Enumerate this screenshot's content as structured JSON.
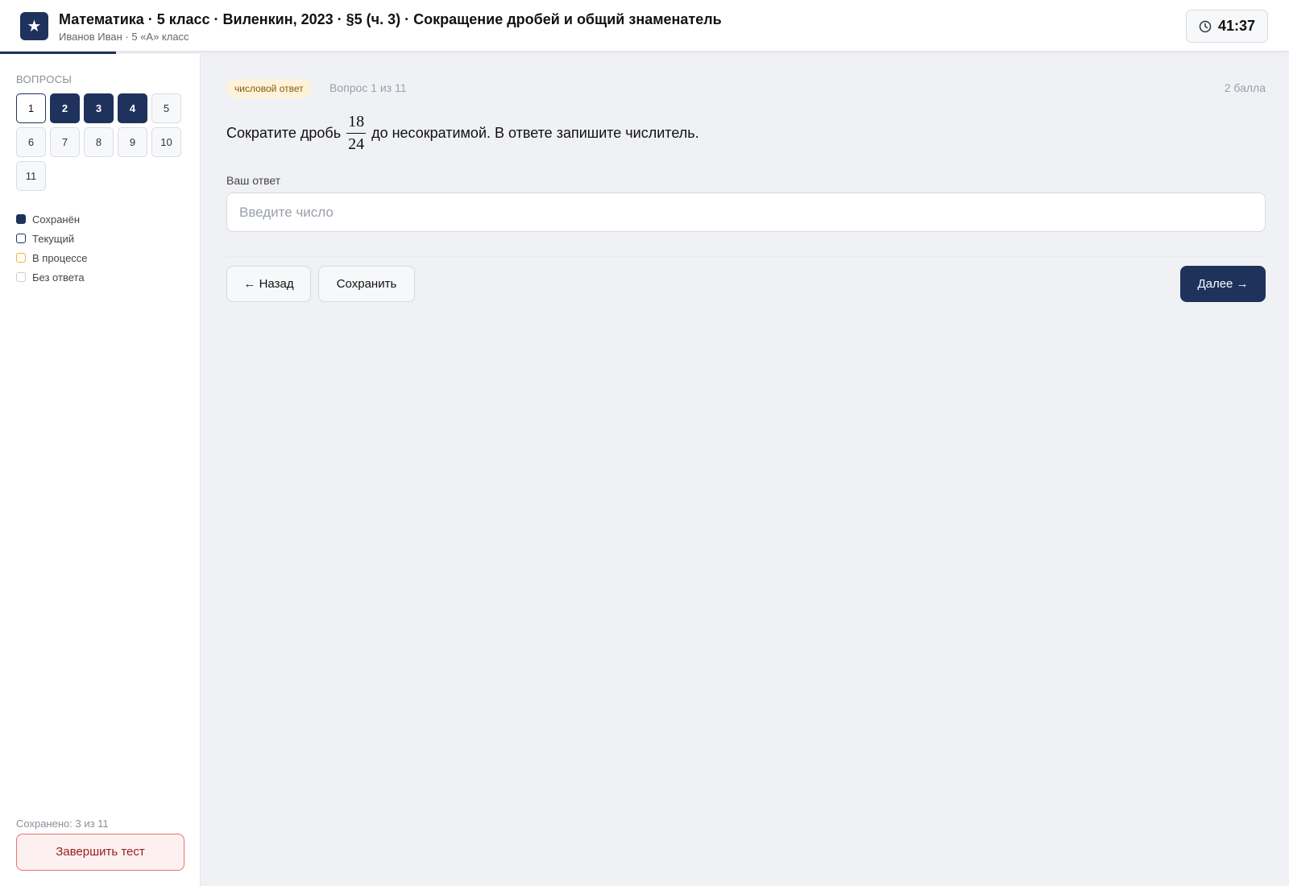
{
  "header": {
    "logo_glyph": "★",
    "title": "Математика · 5 класс · Виленкин, 2023 · §5 (ч. 3) · Сокращение дробей и общий знаменатель",
    "subtitle": "Иванов Иван · 5 «А» класс",
    "timer": "41:37"
  },
  "sidebar": {
    "heading": "ВОПРОСЫ",
    "questions": [
      {
        "label": "1",
        "state": "current"
      },
      {
        "label": "2",
        "state": "saved"
      },
      {
        "label": "3",
        "state": "saved"
      },
      {
        "label": "4",
        "state": "saved"
      },
      {
        "label": "5",
        "state": "none"
      },
      {
        "label": "6",
        "state": "none"
      },
      {
        "label": "7",
        "state": "none"
      },
      {
        "label": "8",
        "state": "none"
      },
      {
        "label": "9",
        "state": "none"
      },
      {
        "label": "10",
        "state": "none"
      },
      {
        "label": "11",
        "state": "none"
      }
    ],
    "legend": {
      "saved": "Сохранён",
      "current": "Текущий",
      "in_progress": "В процессе",
      "no_answer": "Без ответа"
    },
    "saved_count": "Сохранено: 3 из 11",
    "finish_label": "Завершить тест"
  },
  "main": {
    "badge": "числовой ответ",
    "question_number": "Вопрос 1 из 11",
    "points": "2 балла",
    "question_before": "Сократите дробь",
    "fraction_numerator": "18",
    "fraction_denominator": "24",
    "question_after": "до несократимой. В ответе запишите числитель.",
    "answer_label": "Ваш ответ",
    "answer_value": "",
    "answer_placeholder": "Введите число",
    "back_label": "← Назад",
    "save_label": "Сохранить",
    "next_label": "Далее →"
  },
  "colors": {
    "accent": "#1e325c",
    "badge_bg": "#fdf3dc",
    "in_progress": "#f0b429",
    "danger": "#e57373"
  }
}
